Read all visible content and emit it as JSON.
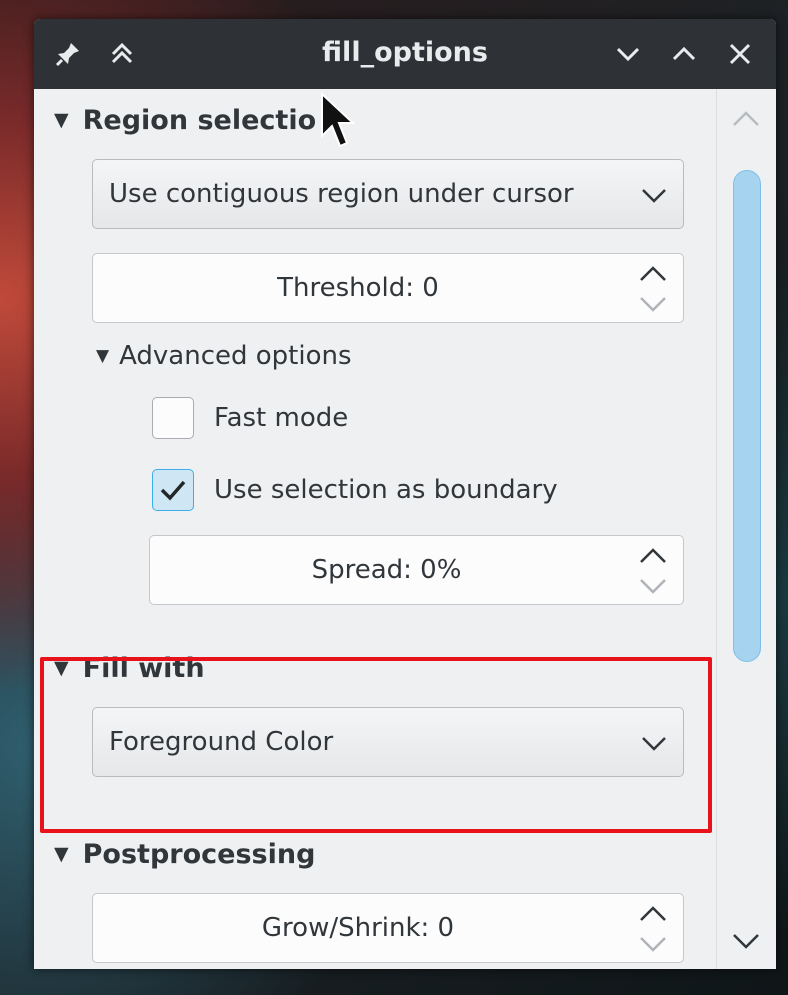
{
  "window": {
    "title": "fill_options",
    "titlebar_icons": [
      "pin-icon",
      "keep-above-icon",
      "minimize-icon",
      "maximize-icon",
      "close-icon"
    ]
  },
  "region_selection": {
    "heading": "Region selectio",
    "mode_combo": "Use contiguous region under cursor",
    "threshold": "Threshold: 0",
    "advanced": {
      "heading": "Advanced options",
      "fast_mode_label": "Fast mode",
      "fast_mode_checked": false,
      "use_selection_label": "Use selection as boundary",
      "use_selection_checked": true,
      "spread": "Spread: 0%"
    }
  },
  "fill_with": {
    "heading": "Fill with",
    "combo": "Foreground Color"
  },
  "postprocessing": {
    "heading": "Postprocessing",
    "grow_shrink": "Grow/Shrink: 0"
  },
  "colors": {
    "titlebar": "#2e3236",
    "panel": "#eff0f1",
    "accent": "#3daee9",
    "highlight_box": "#e8121b"
  }
}
